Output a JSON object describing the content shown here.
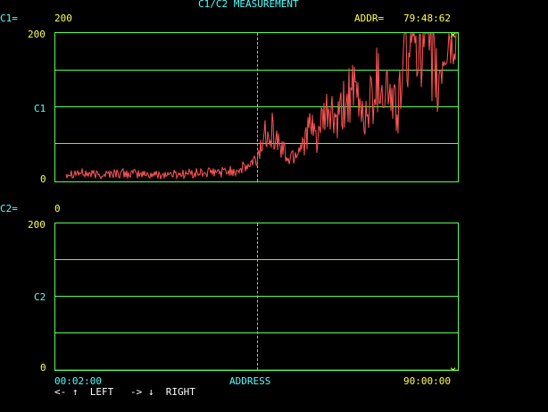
{
  "header": {
    "title": "C1/C2 MEASUREMENT",
    "c1_label": "C1=",
    "c1_value": "200",
    "addr_label": "ADDR=",
    "addr_value": "79:48:62"
  },
  "plot1": {
    "y_top": "200",
    "y_mid": "C1",
    "y_bottom": "0"
  },
  "c2_readout": {
    "label": "C2=",
    "value": "0"
  },
  "plot2": {
    "y_top": "200",
    "y_mid": "C2",
    "y_bottom": "0"
  },
  "footer": {
    "x_start": "00:02:00",
    "x_label": "ADDRESS",
    "x_end": "90:00:00",
    "nav_left": "<- ↑  LEFT",
    "nav_right": "-> ↓  RIGHT"
  },
  "colors": {
    "grid": "#55ff55",
    "trace": "#ff5555",
    "label": "#55ffff",
    "value": "#ffff55"
  },
  "chart_data": {
    "type": "line",
    "title": "C1/C2 MEASUREMENT",
    "xlabel": "ADDRESS",
    "ylim": [
      0,
      200
    ],
    "x_range": [
      "00:02:00",
      "90:00:00"
    ],
    "cursor_x": "79:48:62",
    "series": [
      {
        "name": "C1",
        "x_fraction": [
          0.0,
          0.05,
          0.1,
          0.15,
          0.2,
          0.25,
          0.3,
          0.35,
          0.4,
          0.45,
          0.48,
          0.5,
          0.51,
          0.53,
          0.55,
          0.58,
          0.6,
          0.63,
          0.65,
          0.68,
          0.7,
          0.73,
          0.75,
          0.77,
          0.8,
          0.83,
          0.85,
          0.87,
          0.9,
          0.92,
          0.94,
          0.95,
          0.97,
          1.0
        ],
        "values": [
          10,
          12,
          9,
          11,
          10,
          9,
          10,
          11,
          12,
          15,
          20,
          28,
          45,
          80,
          55,
          30,
          40,
          70,
          60,
          95,
          75,
          120,
          110,
          85,
          140,
          120,
          90,
          180,
          200,
          195,
          160,
          120,
          180,
          200
        ]
      },
      {
        "name": "C2",
        "x_fraction": [
          0.0,
          1.0
        ],
        "values": [
          0,
          0
        ]
      }
    ]
  }
}
